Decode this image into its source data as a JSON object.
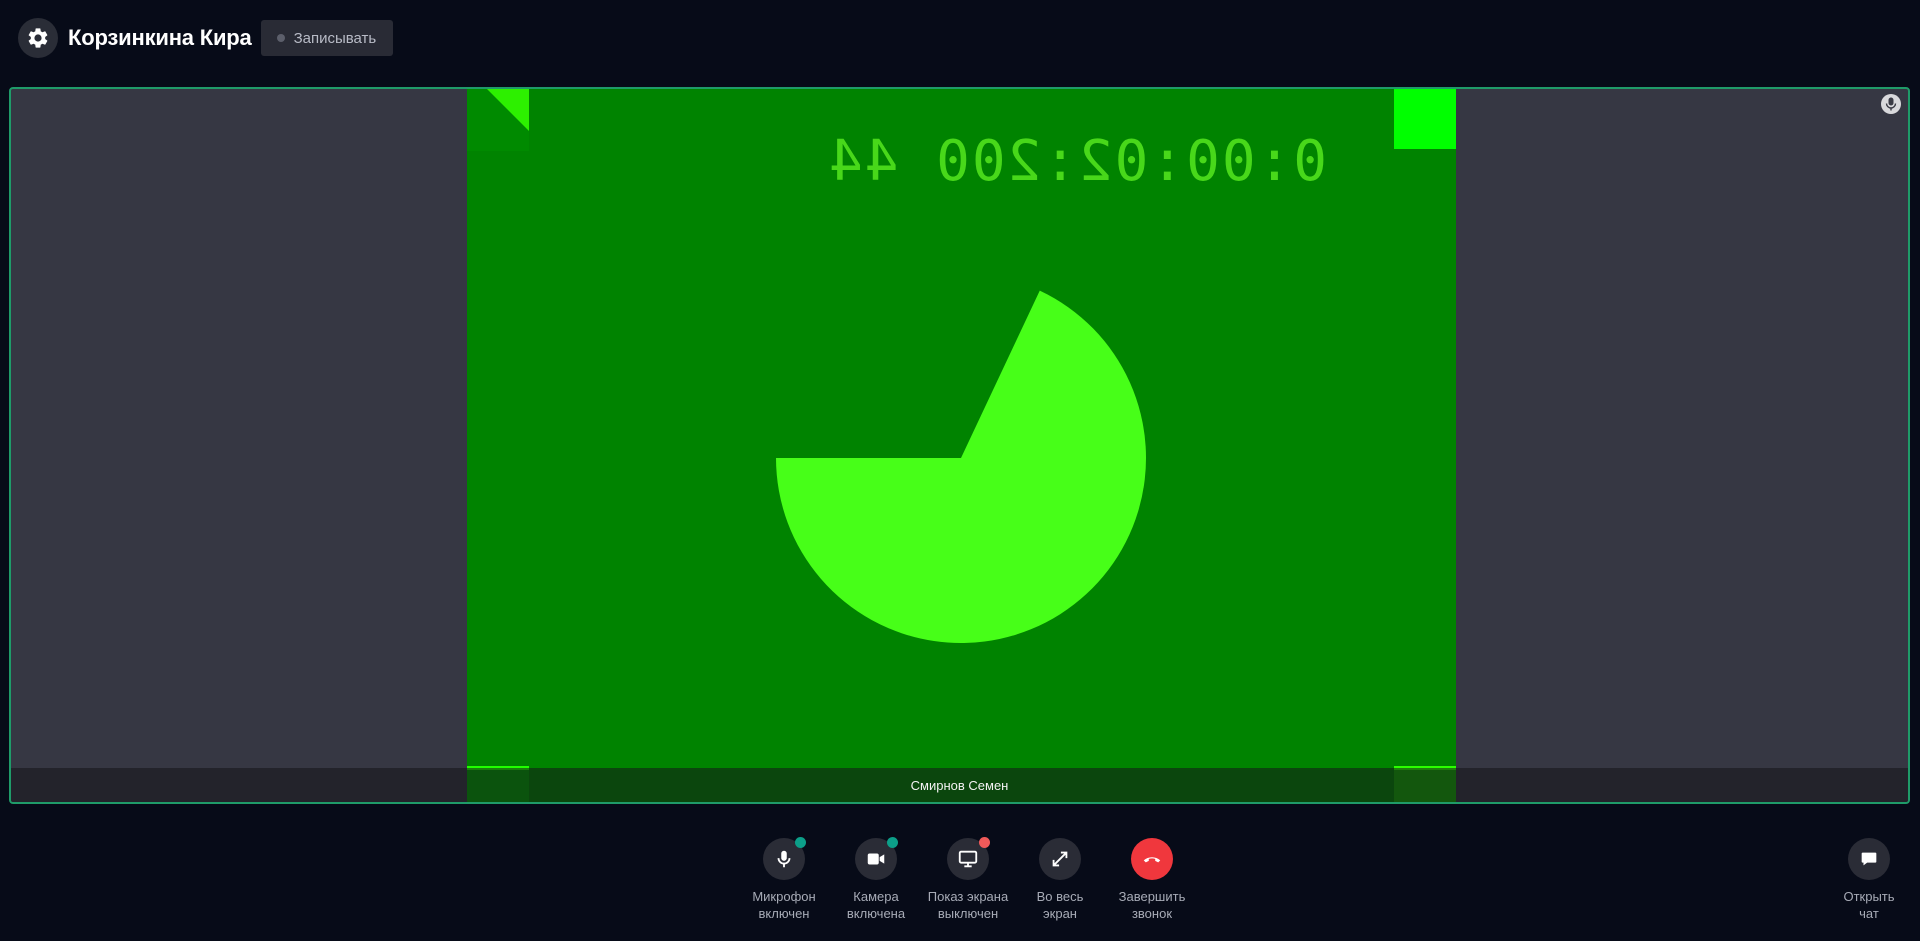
{
  "header": {
    "user_name": "Корзинкина Кира",
    "record_label": "Записывать"
  },
  "video": {
    "timer_text": "0:00:02:200 44",
    "participant_name": "Смирнов Семен",
    "pie_fraction": 0.68
  },
  "controls": [
    {
      "label": "Микрофон\nвключен",
      "icon": "mic-icon",
      "badge": "#0c9f89"
    },
    {
      "label": "Камера\nвключена",
      "icon": "camera-icon",
      "badge": "#0c9f89"
    },
    {
      "label": "Показ экрана\nвыключен",
      "icon": "monitor-icon",
      "badge": "#f05a5a"
    },
    {
      "label": "Во весь\nэкран",
      "icon": "fullscreen-icon"
    },
    {
      "label": "Завершить\nзвонок",
      "icon": "hangup-icon"
    }
  ],
  "chat": {
    "label": "Открыть\nчат",
    "icon": "chat-icon"
  },
  "colors": {
    "background": "#070b18",
    "tile_border": "#1f9b69",
    "video_green": "#008300",
    "pie_green": "#47ff18",
    "hangup_red": "#f0373d"
  }
}
